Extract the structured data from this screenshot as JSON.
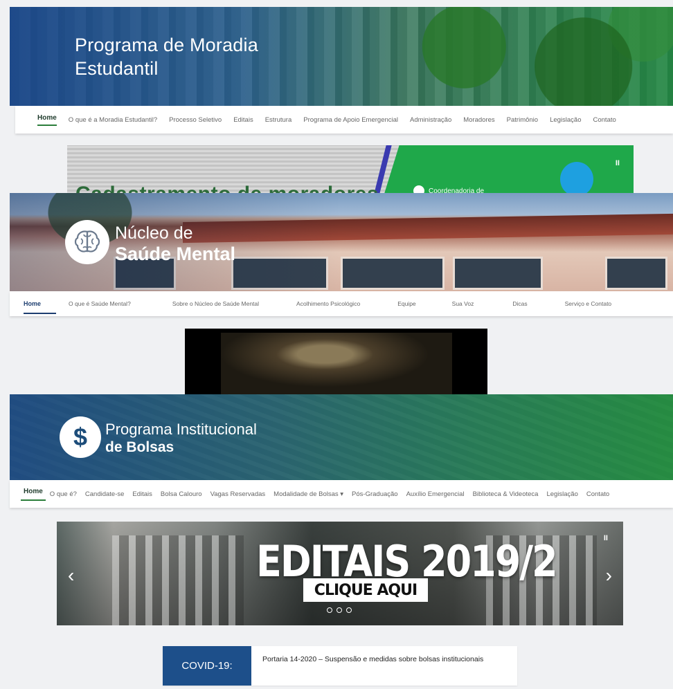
{
  "moradia": {
    "title_line1": "Programa de Moradia",
    "title_line2": "Estudantil",
    "nav": [
      "Home",
      "O que é a Moradia Estudantil?",
      "Processo Seletivo",
      "Editais",
      "Estrutura",
      "Programa de Apoio Emergencial",
      "Administração",
      "Moradores",
      "Patrimônio",
      "Legislação",
      "Contato"
    ],
    "banner": {
      "headline": "Cadastramento de moradores",
      "org": "Coordenadoria de",
      "pause": "II"
    }
  },
  "saude": {
    "title_line1": "Núcleo de",
    "title_line2": "Saúde Mental",
    "icon": "brain-icon",
    "nav": [
      "Home",
      "O que é Saúde Mental?",
      "Sobre o Núcleo de Saúde Mental",
      "Acolhimento Psicológico",
      "Equipe",
      "Sua Voz",
      "Dicas",
      "Serviço e Contato"
    ]
  },
  "bolsas": {
    "title_line1": "Programa Institucional",
    "title_line2": "de Bolsas",
    "icon_glyph": "$",
    "nav": [
      "Home",
      "O que é?",
      "Candidate-se",
      "Editais",
      "Bolsa Calouro",
      "Vagas Reservadas",
      "Modalidade de Bolsas ▾",
      "Pós-Graduação",
      "Auxílio Emergencial",
      "Biblioteca & Videoteca",
      "Legislação",
      "Contato"
    ],
    "slider": {
      "headline": "EDITAIS 2019/2",
      "cta": "CLIQUE AQUI",
      "prev": "‹",
      "next": "›",
      "pause": "II"
    },
    "covid": {
      "tag": "COVID-19:",
      "text": "Portaria 14-2020 – Suspensão e medidas sobre bolsas institucionais"
    }
  },
  "colors": {
    "accent_green": "#2a7d3a",
    "accent_blue": "#1d4f8a"
  }
}
